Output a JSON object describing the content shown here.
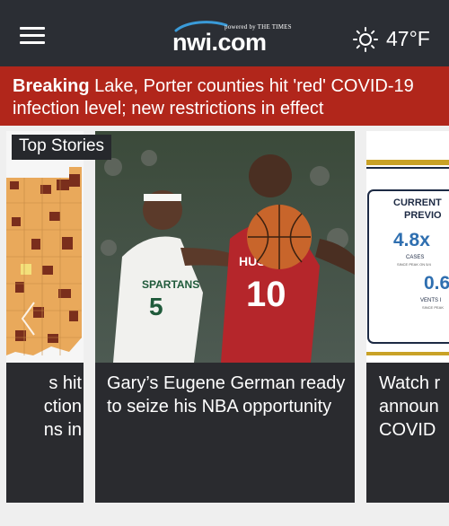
{
  "header": {
    "logo_tagline": "powered by THE TIMES",
    "logo_text": "nwi.com",
    "temperature": "47°F",
    "menu_icon": "hamburger-menu-icon",
    "weather_icon": "sun-icon"
  },
  "breaking": {
    "label": "Breaking",
    "text": "Lake, Porter counties hit 'red' COVID-19 infection level; new restrictions in effect"
  },
  "top_stories": {
    "label": "Top Stories",
    "cards": [
      {
        "title": "s hit\nction\nns in"
      },
      {
        "title": "Gary’s Eugene German ready to seize his NBA opportunity"
      },
      {
        "title": "Watch r\nannoun\nCOVID"
      }
    ],
    "right_card_graphic": {
      "line1": "CURRENT",
      "line2": "PREVIO",
      "value1": "4.8x",
      "caption1": "CASES",
      "caption1b": "SINCE PEAK ON 5/4",
      "value2": "0.6",
      "caption2": "VENTS I",
      "caption2b": "SINCE PEAK"
    }
  },
  "colors": {
    "header_bg": "#2b2e34",
    "breaking_bg": "#b1261b",
    "card_bg": "#2a2b2f"
  }
}
